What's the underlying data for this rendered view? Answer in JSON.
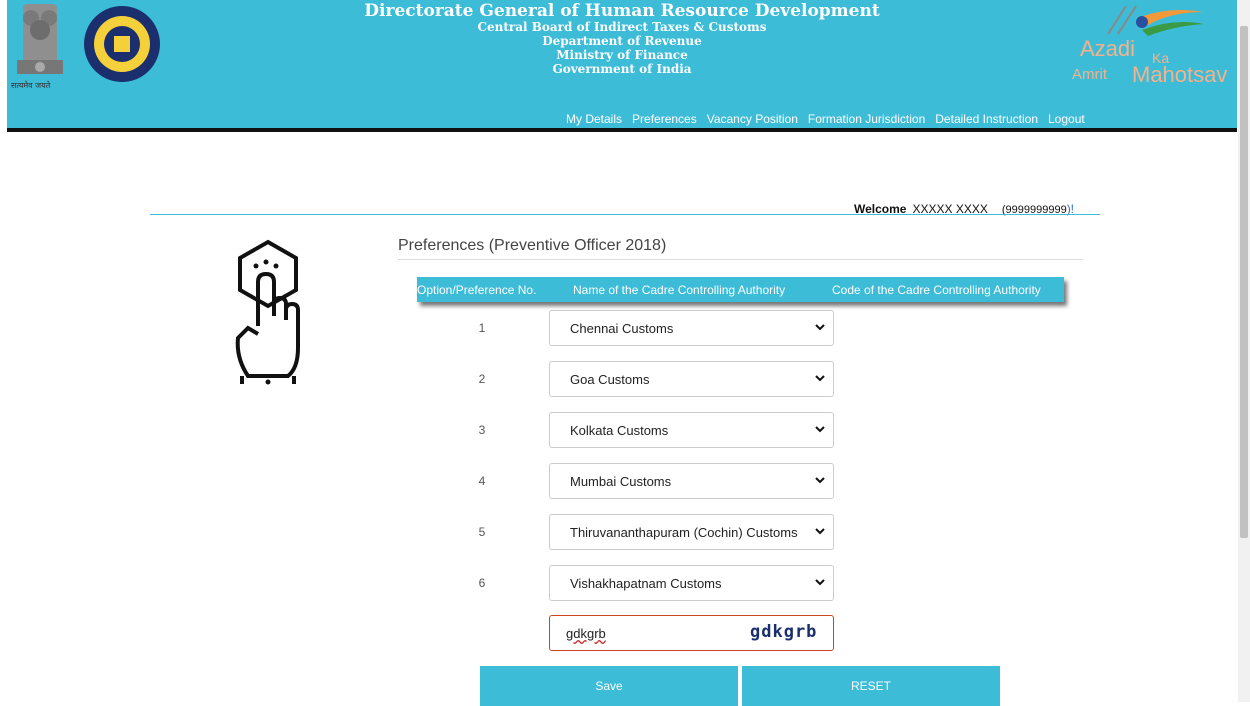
{
  "header": {
    "title": "Directorate General of Human Resource Development",
    "lines": [
      "Central Board of Indirect Taxes & Customs",
      "Department of Revenue",
      "Ministry of Finance",
      "Government of India"
    ],
    "emblem_text": "सत्यमेव जयते",
    "aka": {
      "azadi": "Azadi",
      "ka": "Ka",
      "amrit": "Amrit",
      "mahotsav": "Mahotsav"
    },
    "nav": [
      "My Details",
      "Preferences",
      "Vacancy Position",
      "Formation Jurisdiction",
      "Detailed Instruction",
      "Logout"
    ],
    "color": "#3dbcd8"
  },
  "welcome": {
    "label": "Welcome",
    "name": "XXXXX XXXX",
    "mobile": "(9999999999",
    "close": ")!"
  },
  "page": {
    "title": "Preferences (Preventive Officer 2018)"
  },
  "table": {
    "headers": [
      "Option/Preference No.",
      "Name of the Cadre Controlling Authority",
      "Code of the Cadre Controlling Authority"
    ],
    "rows": [
      {
        "no": "1",
        "value": "Chennai Customs"
      },
      {
        "no": "2",
        "value": "Goa Customs"
      },
      {
        "no": "3",
        "value": "Kolkata Customs"
      },
      {
        "no": "4",
        "value": "Mumbai Customs"
      },
      {
        "no": "5",
        "value": "Thiruvananthapuram (Cochin) Customs"
      },
      {
        "no": "6",
        "value": "Vishakhapatnam Customs"
      }
    ]
  },
  "captcha": {
    "value": "gdkgrb",
    "image_text": "gdkgrb"
  },
  "buttons": {
    "save": "Save",
    "reset": "RESET"
  }
}
